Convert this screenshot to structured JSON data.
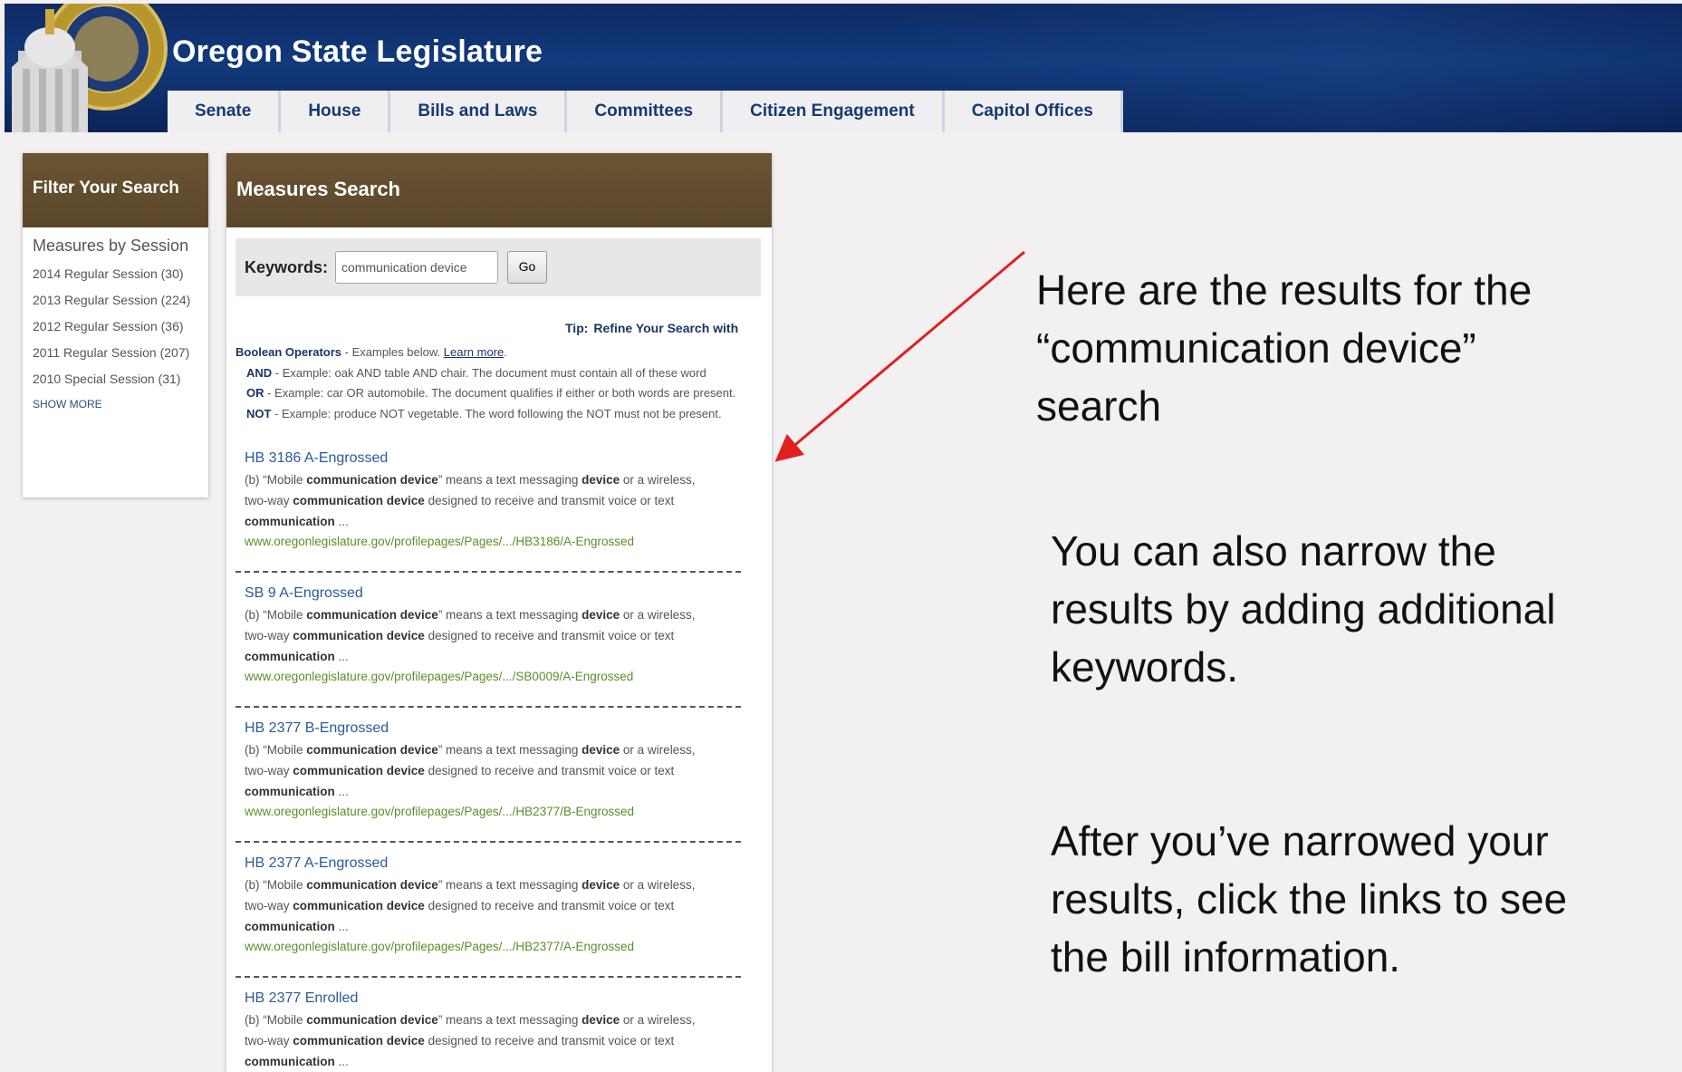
{
  "site": {
    "title": "Oregon State Legislature"
  },
  "nav": [
    "Senate",
    "House",
    "Bills and Laws",
    "Committees",
    "Citizen Engagement",
    "Capitol Offices"
  ],
  "filter": {
    "heading": "Filter Your Search",
    "subheading": "Measures by Session",
    "sessions": [
      "2014 Regular Session (30)",
      "2013 Regular Session (224)",
      "2012 Regular Session (36)",
      "2011 Regular Session (207)",
      "2010 Special Session (31)"
    ],
    "show_more": "SHOW MORE"
  },
  "search": {
    "heading": "Measures Search",
    "keywords_label": "Keywords:",
    "keywords_value": "communication device",
    "go_label": "Go",
    "tip_label": "Tip:",
    "tip_text": "Refine Your Search with",
    "boolean_label": "Boolean Operators",
    "boolean_text": " - Examples below. ",
    "learn_more": "Learn more",
    "learn_more_period": ".",
    "operators": [
      {
        "op": "AND",
        "text": " - Example: oak AND table AND chair.  The document must contain all of these word"
      },
      {
        "op": "OR",
        "text": " - Example: car OR automobile.  The document qualifies if either or both words are present."
      },
      {
        "op": "NOT",
        "text": " - Example: produce NOT vegetable.  The word following the NOT must not be present."
      }
    ]
  },
  "snippet": {
    "p1": "(b) “Mobile ",
    "b1": "communication device",
    "p2": "” means a text messaging ",
    "b2": "device",
    "p3": " or a wireless,",
    "p4": "two-way ",
    "b3": "communication device",
    "p5": " designed to receive and transmit voice or text",
    "b4": "communication",
    "p6": " ..."
  },
  "results": [
    {
      "title": "HB 3186 A-Engrossed",
      "url": "www.oregonlegislature.gov/profilepages/Pages/.../HB3186/A-Engrossed"
    },
    {
      "title": "SB 9 A-Engrossed",
      "url": "www.oregonlegislature.gov/profilepages/Pages/.../SB0009/A-Engrossed"
    },
    {
      "title": "HB 2377 B-Engrossed",
      "url": "www.oregonlegislature.gov/profilepages/Pages/.../HB2377/B-Engrossed"
    },
    {
      "title": "HB 2377 A-Engrossed",
      "url": "www.oregonlegislature.gov/profilepages/Pages/.../HB2377/A-Engrossed"
    },
    {
      "title": "HB 2377 Enrolled",
      "url": ""
    }
  ],
  "annotations": {
    "note1": [
      "Here are the results for the",
      "“communication device”",
      "search"
    ],
    "note2": [
      "You can also narrow the",
      "results by adding additional",
      "keywords."
    ],
    "note3": [
      "After you’ve narrowed your",
      "results, click the links to see",
      "the bill information."
    ]
  },
  "colors": {
    "header": "#0e2a63",
    "panel_head": "#5f4a2d",
    "arrow": "#e02020",
    "link": "#2a5a9a",
    "url": "#5b8f28"
  }
}
